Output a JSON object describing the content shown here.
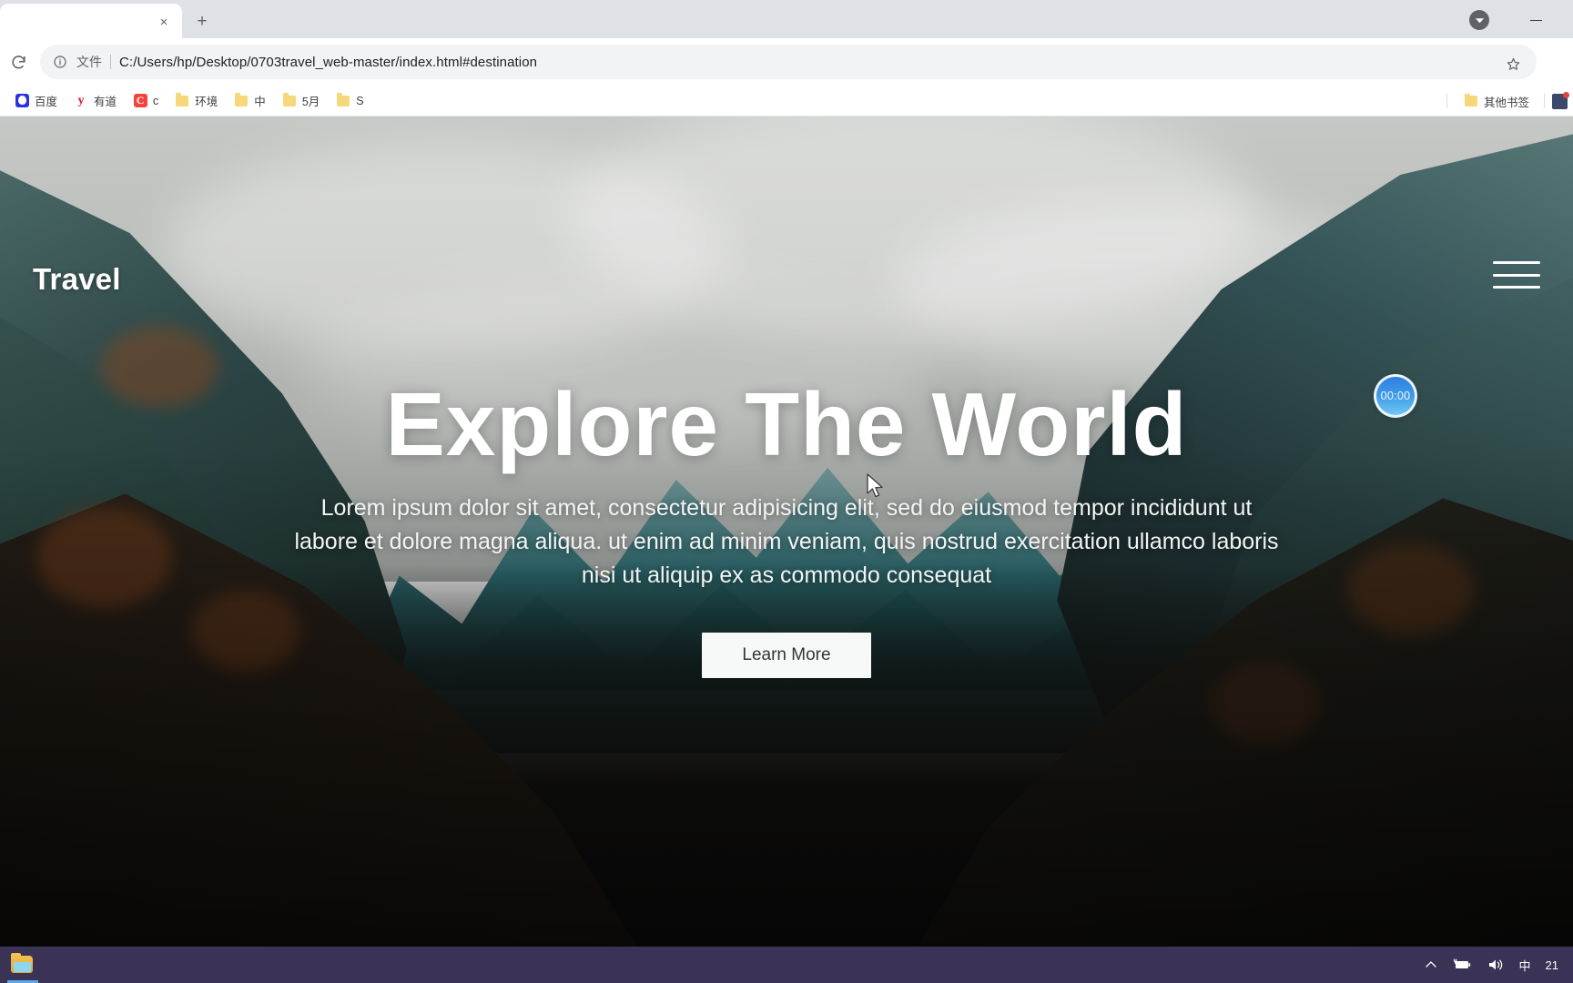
{
  "browser": {
    "tab": {
      "title": "",
      "close_label": "×",
      "new_tab_label": "+"
    },
    "window_controls": {
      "minimize_label": "—"
    },
    "toolbar": {
      "reload_icon": "reload-icon",
      "info_icon": "info-circle-icon",
      "scheme_label": "文件",
      "url": "C:/Users/hp/Desktop/0703travel_web-master/index.html#destination",
      "star_icon": "star-icon"
    },
    "bookmarks": [
      {
        "label": "百度",
        "icon": "baidu-favicon"
      },
      {
        "label": "有道",
        "icon": "youdao-favicon"
      },
      {
        "label": "c",
        "icon": "c-favicon"
      },
      {
        "label": "环境",
        "icon": "folder-icon"
      },
      {
        "label": "中",
        "icon": "folder-icon"
      },
      {
        "label": "5月",
        "icon": "folder-icon"
      },
      {
        "label": "S",
        "icon": "folder-icon"
      }
    ],
    "bookmarks_right": {
      "label": "其他书签",
      "icon": "folder-icon",
      "extension_icon": "extension-icon"
    }
  },
  "site": {
    "logo": "Travel",
    "menu_icon": "hamburger-menu-icon",
    "timer": {
      "label": "00:00",
      "icon": "timer-badge-icon"
    },
    "hero": {
      "title": "Explore The World",
      "subtitle": "Lorem ipsum dolor sit amet, consectetur adipisicing elit, sed do eiusmod tempor incididunt ut labore et dolore magna aliqua. ut enim ad minim veniam, quis nostrud exercitation ullamco laboris nisi ut aliquip ex as commodo consequat",
      "cta_label": "Learn More"
    }
  },
  "taskbar": {
    "file_explorer_icon": "file-explorer-icon",
    "tray": {
      "chevron_icon": "chevron-up-icon",
      "battery_icon": "battery-charging-icon",
      "volume_icon": "volume-icon",
      "ime_label": "中",
      "clock_label": "21"
    }
  },
  "colors": {
    "accent": "#3f9ae8",
    "tab_strip": "#dee1e6",
    "omnibox": "#f1f3f4",
    "taskbar": "#3b3356",
    "hero_text": "#ffffff"
  }
}
